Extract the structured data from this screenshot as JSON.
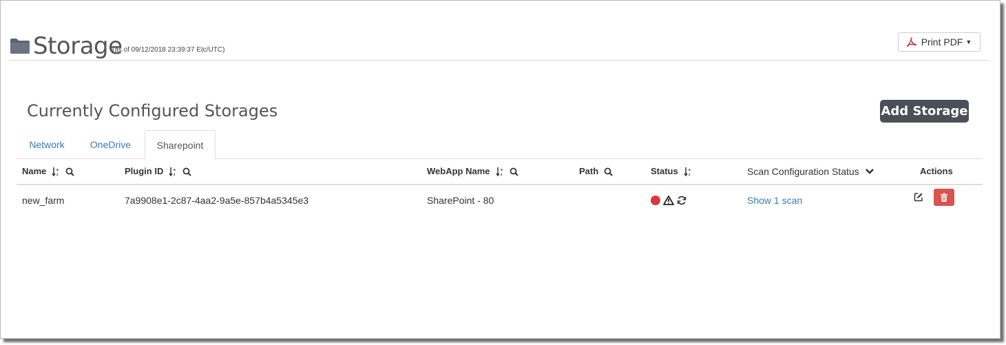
{
  "header": {
    "title": "Storage",
    "timestamp": "(as of 09/12/2018 23:39:37 Etc/UTC)",
    "print_label": "Print PDF"
  },
  "section": {
    "title": "Currently Configured Storages",
    "add_label": "Add Storage"
  },
  "tabs": [
    {
      "label": "Network"
    },
    {
      "label": "OneDrive"
    },
    {
      "label": "Sharepoint",
      "active": true
    }
  ],
  "columns": {
    "name": "Name",
    "plugin_id": "Plugin ID",
    "webapp": "WebApp Name",
    "path": "Path",
    "status": "Status",
    "scan": "Scan Configuration Status",
    "actions": "Actions"
  },
  "rows": [
    {
      "name": "new_farm",
      "plugin_id": "7a9908e1-2c87-4aa2-9a5e-857b4a5345e3",
      "webapp": "SharePoint - 80",
      "path": "",
      "status_icons": [
        "red-dot",
        "warning-icon",
        "refresh-icon"
      ],
      "scan_link": "Show 1 scan"
    }
  ],
  "colors": {
    "link": "#3a7ab8",
    "add_button": "#4b5058",
    "delete_button": "#d9534f",
    "status_red": "#d9383a"
  }
}
